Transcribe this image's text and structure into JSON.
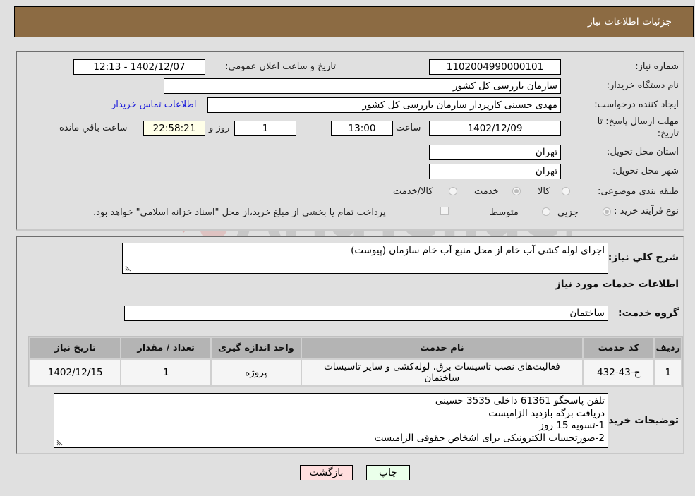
{
  "header": {
    "title": "جزئيات اطلاعات نياز"
  },
  "details": {
    "need_number_label": "شماره نیاز:",
    "need_number": "1102004990000101",
    "announce_label": "تاريخ و ساعت اعلان عمومي:",
    "announce_value": "1402/12/07 - 12:13",
    "buyer_org_label": "نام دستگاه خریدار:",
    "buyer_org": "سازمان بازرسی کل کشور",
    "creator_label": "ایجاد کننده درخواست:",
    "creator": "مهدی حسینی کارپرداز سازمان بازرسی کل کشور",
    "contact_link": "اطلاعات تماس خریدار",
    "deadline_label": "مهلت ارسال پاسخ: تا تاریخ:",
    "deadline_date": "1402/12/09",
    "time_label": "ساعت",
    "deadline_time": "13:00",
    "days_value": "1",
    "days_label": "روز و",
    "remaining_time": "22:58:21",
    "remaining_label": "ساعت باقي مانده",
    "province_label": "استان محل تحویل:",
    "province": "تهران",
    "city_label": "شهر محل تحویل:",
    "city": "تهران",
    "category_label": "طبقه بندی موضوعی:",
    "category_options": [
      {
        "label": "کالا",
        "checked": false
      },
      {
        "label": "خدمت",
        "checked": true
      },
      {
        "label": "کالا/خدمت",
        "checked": false
      }
    ],
    "process_label": "نوع فرآیند خرید :",
    "process_options": [
      {
        "label": "جزيي",
        "checked": true
      },
      {
        "label": "متوسط",
        "checked": false
      }
    ],
    "treasury_note": "پرداخت تمام یا بخشی از مبلغ خرید،از محل \"اسناد خزانه اسلامی\" خواهد بود.",
    "treasury_checked": false
  },
  "summary": {
    "description_label": "شرح کلي نياز:",
    "description": "اجرای لوله کشی آب خام از محل منبع آب خام سازمان (پیوست)",
    "services_heading": "اطلاعات خدمات مورد نياز",
    "service_group_label": "گروه خدمت:",
    "service_group": "ساختمان"
  },
  "table": {
    "headers": [
      "ردیف",
      "کد خدمت",
      "نام خدمت",
      "واحد اندازه گیری",
      "تعداد / مقدار",
      "تاریخ نیاز"
    ],
    "rows": [
      {
        "row": "1",
        "code": "ج-43-432",
        "name": "فعالیت‌های نصب تاسیسات برق، لوله‌کشی و سایر تاسیسات ساختمان",
        "unit": "پروژه",
        "quantity": "1",
        "date": "1402/12/15"
      }
    ]
  },
  "buyer_notes": {
    "label": "توضیحات خریدار:",
    "lines": [
      "تلفن پاسخگو 61361    داخلی 3535 حسینی",
      "دریافت برگه بازدید الزامیست",
      "1-تسویه 15 روز",
      "2-صورتحساب الکترونیکی برای اشخاص حقوقی الزامیست"
    ]
  },
  "buttons": {
    "print": "چاپ",
    "back": "بازگشت"
  },
  "watermark": {
    "text": "AriaTender.neT"
  }
}
